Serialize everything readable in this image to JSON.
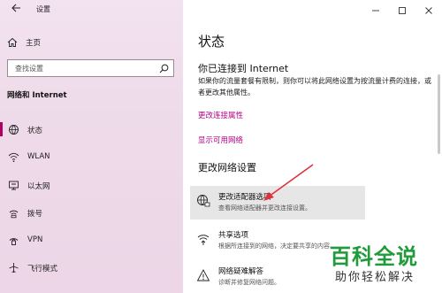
{
  "window": {
    "title": "设置",
    "controls": [
      "minimize-icon",
      "maximize-icon",
      "close-icon"
    ]
  },
  "sidebar": {
    "home_label": "主页",
    "search_placeholder": "查找设置",
    "section_title": "网络和 Internet",
    "items": [
      {
        "label": "状态",
        "icon": "status-icon",
        "active": true
      },
      {
        "label": "WLAN",
        "icon": "wifi-icon",
        "active": false
      },
      {
        "label": "以太网",
        "icon": "ethernet-icon",
        "active": false
      },
      {
        "label": "拨号",
        "icon": "dialup-icon",
        "active": false
      },
      {
        "label": "VPN",
        "icon": "vpn-icon",
        "active": false
      },
      {
        "label": "飞行模式",
        "icon": "airplane-icon",
        "active": false
      }
    ]
  },
  "main": {
    "page_title": "状态",
    "connection_heading": "你已连接到 Internet",
    "connection_desc": "如果你的流量套餐有限制，则你可以将此网络设置为按流量计费的连接，或者更改其他属性。",
    "links": [
      "更改连接属性",
      "显示可用网络"
    ],
    "change_section_title": "更改网络设置",
    "options": [
      {
        "title": "更改适配器选项",
        "subtitle": "查看网络适配器并更改连接设置。",
        "icon": "adapter-icon"
      },
      {
        "title": "共享选项",
        "subtitle": "根据所连接到的网络，决定要共享的内容。",
        "icon": "sharing-icon"
      },
      {
        "title": "网络疑难解答",
        "subtitle": "诊断并修复网络问题。",
        "icon": "warning-icon"
      }
    ]
  },
  "watermark": {
    "big": "百科全说",
    "small": "助你轻松解决"
  },
  "colors": {
    "accent": "#b40088",
    "sidebar_bg": "#efdcea",
    "watermark_green": "#1f9b3a"
  }
}
